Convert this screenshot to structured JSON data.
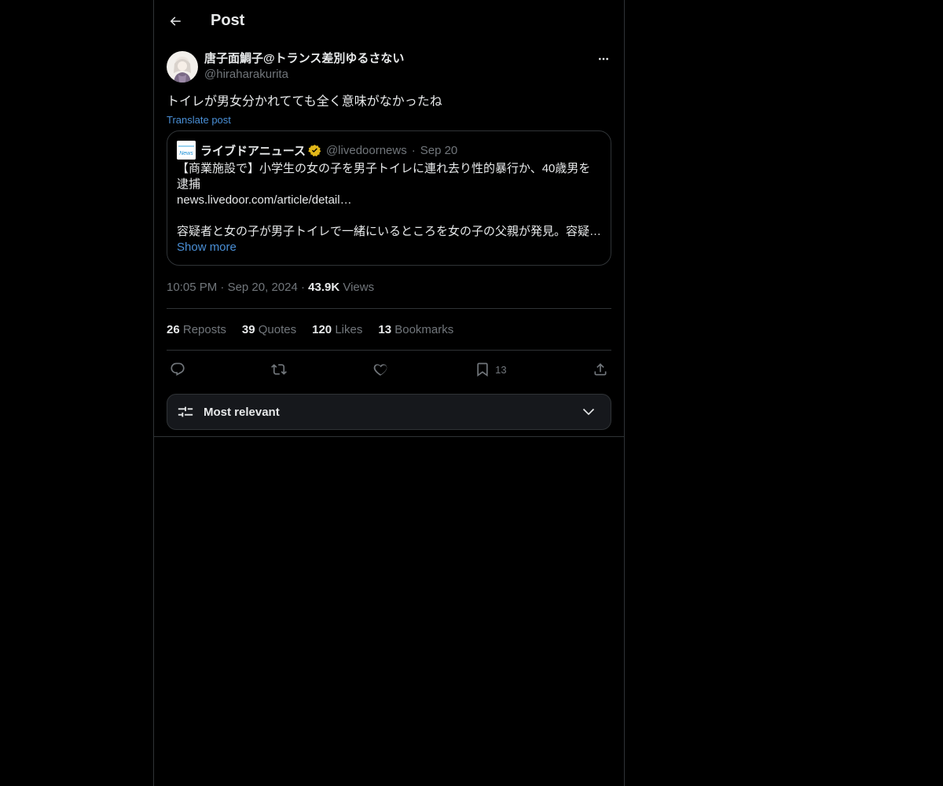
{
  "header": {
    "title": "Post"
  },
  "post": {
    "author": {
      "display_name": "唐子面鯛子@トランス差別ゆるさない",
      "handle": "@hiraharakurita"
    },
    "text": "トイレが男女分かれてても全く意味がなかったね",
    "translate_label": "Translate post",
    "quote": {
      "avatar_text": "News",
      "name": "ライブドアニュース",
      "handle": "@livedoornews",
      "separator": "·",
      "date": "Sep 20",
      "body_line1": "【商業施設で】小学生の女の子を男子トイレに連れ去り性的暴行か、40歳男を逮捕",
      "body_link": "news.livedoor.com/article/detail…",
      "body_line3": "容疑者と女の子が男子トイレで一緒にいるところを女の子の父親が発見。容疑…",
      "show_more": "Show more"
    },
    "meta": {
      "time": "10:05 PM",
      "sep1": "·",
      "date": "Sep 20, 2024",
      "sep2": "·",
      "views_count": "43.9K",
      "views_label": "Views"
    },
    "stats": {
      "reposts_count": "26",
      "reposts_label": "Reposts",
      "quotes_count": "39",
      "quotes_label": "Quotes",
      "likes_count": "120",
      "likes_label": "Likes",
      "bookmarks_count": "13",
      "bookmarks_label": "Bookmarks"
    },
    "actions": {
      "bookmark_count": "13"
    }
  },
  "replies_sort": {
    "label": "Most relevant"
  },
  "colors": {
    "background": "#000000",
    "text": "#e7e9ea",
    "muted": "#71767b",
    "link": "#4a8fd6",
    "border": "#2f3336",
    "verified": "#e2b719"
  }
}
